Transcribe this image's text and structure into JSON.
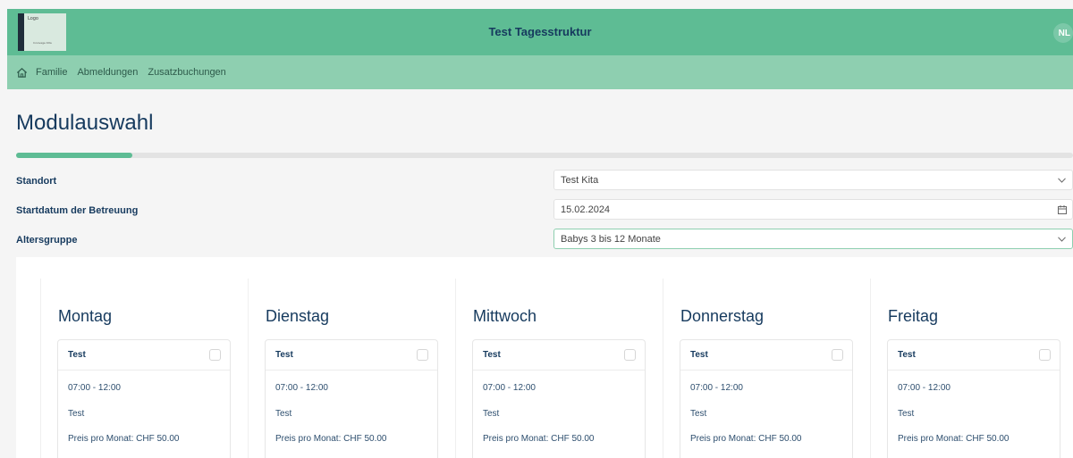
{
  "header": {
    "logo": {
      "top_text": "Logo",
      "bottom_text": "Innovage Kita"
    },
    "title": "Test Tagesstruktur",
    "avatar_initials": "NL"
  },
  "nav": {
    "home_icon": "home-icon",
    "items": [
      {
        "label": "Familie"
      },
      {
        "label": "Abmeldungen"
      },
      {
        "label": "Zusatzbuchungen"
      }
    ]
  },
  "page": {
    "title": "Modulauswahl",
    "progress_percent": 11
  },
  "form": {
    "standort": {
      "label": "Standort",
      "value": "Test Kita",
      "icon": "chevron-down-icon"
    },
    "startdatum": {
      "label": "Startdatum der Betreuung",
      "value": "15.02.2024",
      "icon": "calendar-icon"
    },
    "altersgruppe": {
      "label": "Altersgruppe",
      "value": "Babys 3 bis 12 Monate",
      "icon": "chevron-down-icon"
    }
  },
  "days": [
    {
      "name": "Montag",
      "module": {
        "name": "Test",
        "time": "07:00 - 12:00",
        "description": "Test",
        "price": "Preis pro Monat: CHF 50.00",
        "selected": false
      }
    },
    {
      "name": "Dienstag",
      "module": {
        "name": "Test",
        "time": "07:00 - 12:00",
        "description": "Test",
        "price": "Preis pro Monat: CHF 50.00",
        "selected": false
      }
    },
    {
      "name": "Mittwoch",
      "module": {
        "name": "Test",
        "time": "07:00 - 12:00",
        "description": "Test",
        "price": "Preis pro Monat: CHF 50.00",
        "selected": false
      }
    },
    {
      "name": "Donnerstag",
      "module": {
        "name": "Test",
        "time": "07:00 - 12:00",
        "description": "Test",
        "price": "Preis pro Monat: CHF 50.00",
        "selected": false
      }
    },
    {
      "name": "Freitag",
      "module": {
        "name": "Test",
        "time": "07:00 - 12:00",
        "description": "Test",
        "price": "Preis pro Monat: CHF 50.00",
        "selected": false
      }
    }
  ],
  "colors": {
    "header_bg": "#5ebc94",
    "nav_bg": "#8ecfb0",
    "title_text": "#163a5e",
    "progress_fill": "#5ebc94"
  }
}
